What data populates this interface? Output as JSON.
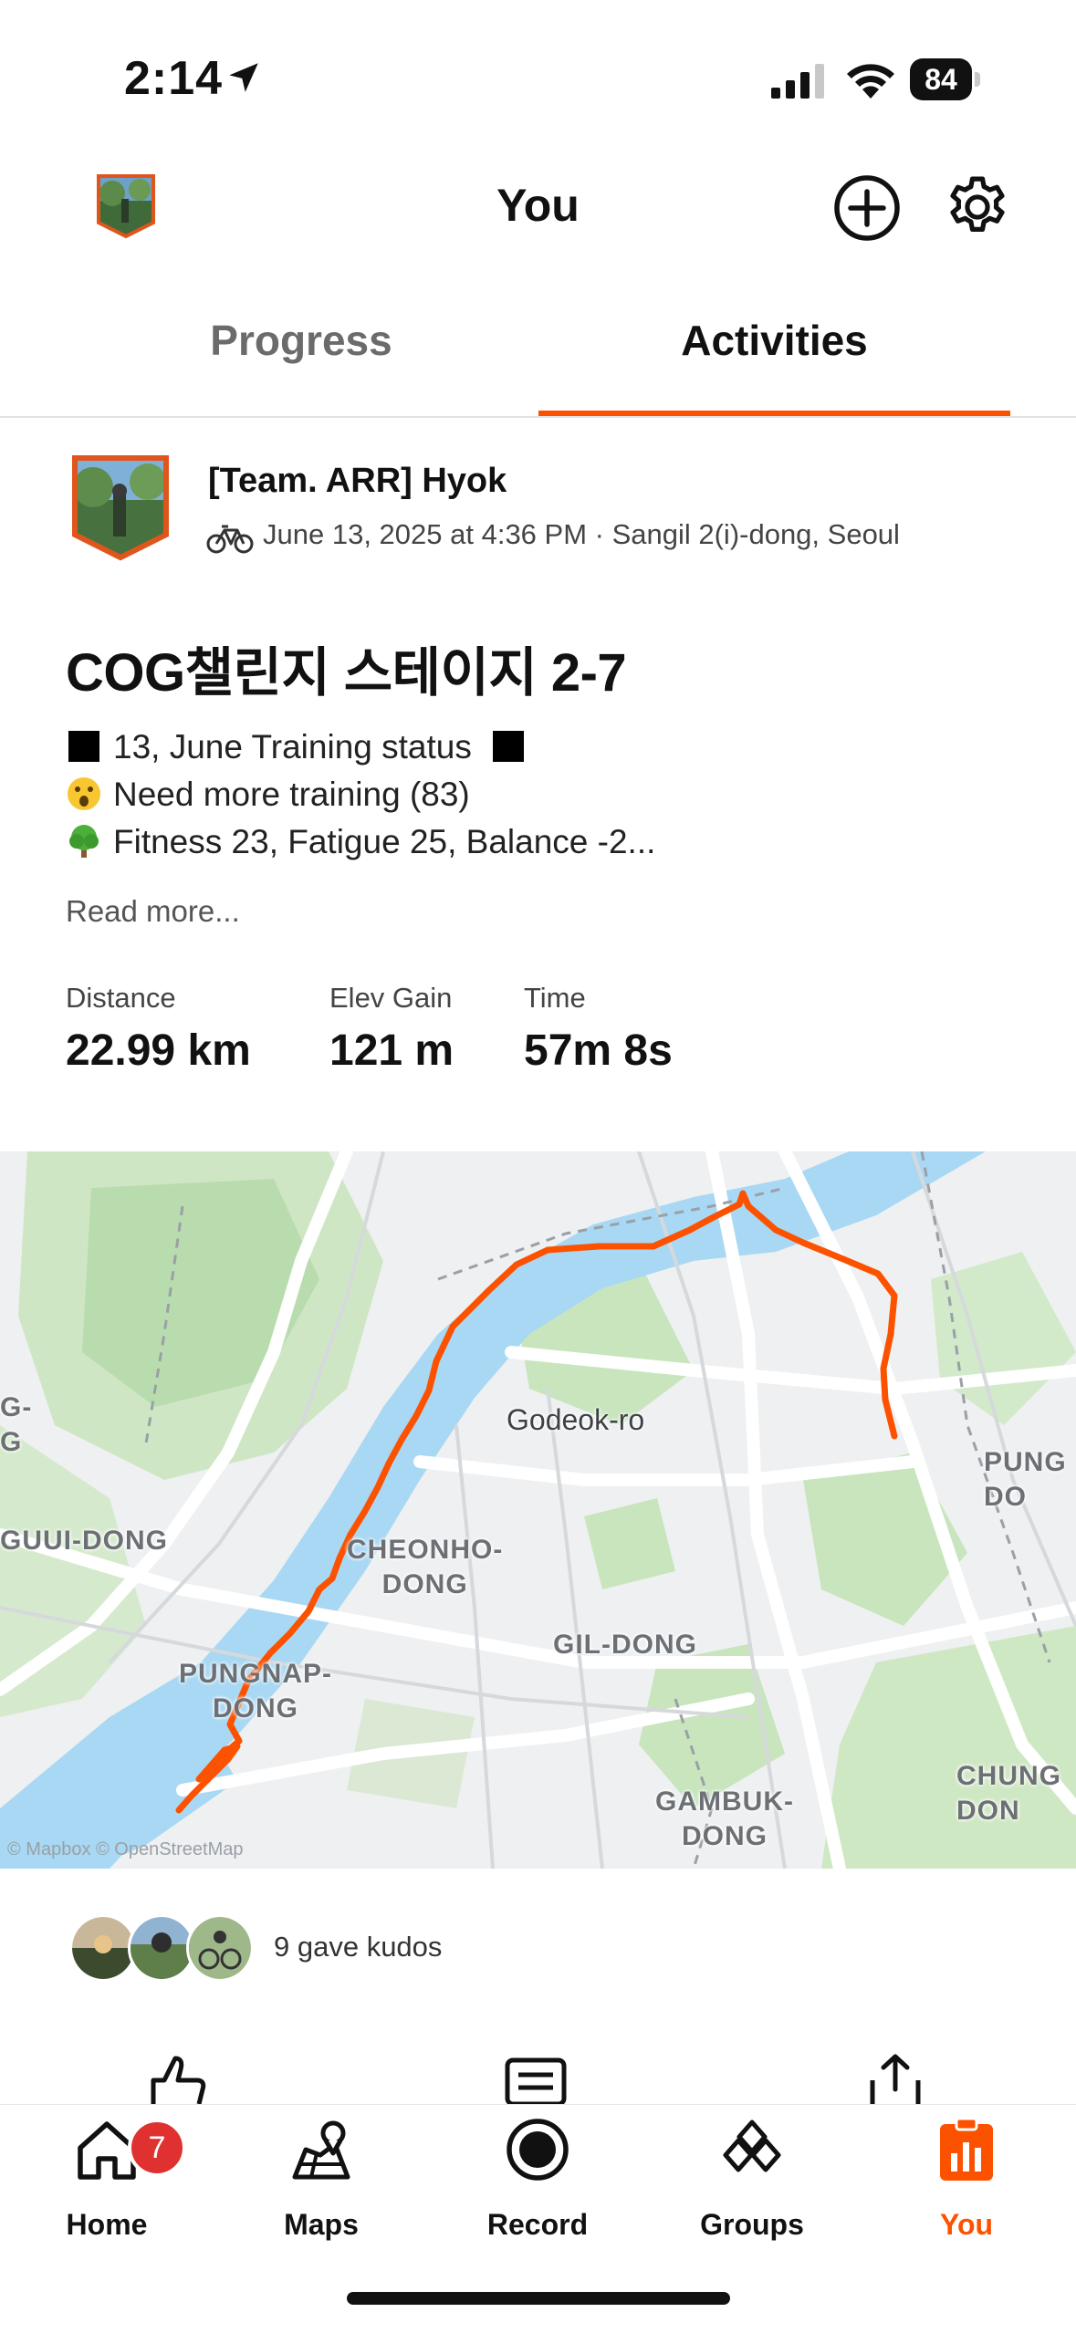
{
  "status_bar": {
    "time": "2:14",
    "battery": "84"
  },
  "header": {
    "title": "You"
  },
  "tabs": [
    {
      "label": "Progress",
      "active": false
    },
    {
      "label": "Activities",
      "active": true
    }
  ],
  "activity": {
    "athlete_name": "[Team. ARR] Hyok",
    "meta": "June 13, 2025 at 4:36 PM · Sangil 2(i)-dong, Seoul",
    "title": "COG챌린지 스테이지 2-7",
    "description": [
      {
        "icon": "black-square-icon",
        "text": "13, June Training status"
      },
      {
        "icon": "surprised-face-icon",
        "text": "Need more training (83)"
      },
      {
        "icon": "tree-icon",
        "text": "Fitness 23, Fatigue 25, Balance -2..."
      }
    ],
    "read_more": "Read more...",
    "stats": [
      {
        "label": "Distance",
        "value": "22.99 km"
      },
      {
        "label": "Elev Gain",
        "value": "121 m"
      },
      {
        "label": "Time",
        "value": "57m 8s"
      }
    ]
  },
  "map": {
    "road_label": "Godeok-ro",
    "area_labels": {
      "guui": "GUUI-DONG",
      "cheonho": "CHEONHO-\nDONG",
      "pungnap": "PUNGNAP-\nDONG",
      "gil": "GIL-DONG",
      "gambuk": "GAMBUK-\nDONG",
      "pung_right": "PUNG\nDO",
      "chung": "CHUNG\nDON",
      "left_g": "G-\nG"
    },
    "attribution": "© Mapbox © OpenStreetMap",
    "route_color": "#fc5200"
  },
  "kudos": {
    "text": "9 gave kudos"
  },
  "bottom_nav": [
    {
      "label": "Home",
      "badge": "7"
    },
    {
      "label": "Maps"
    },
    {
      "label": "Record"
    },
    {
      "label": "Groups"
    },
    {
      "label": "You",
      "active": true
    }
  ],
  "colors": {
    "accent": "#fc5200",
    "badge": "#e03131"
  }
}
